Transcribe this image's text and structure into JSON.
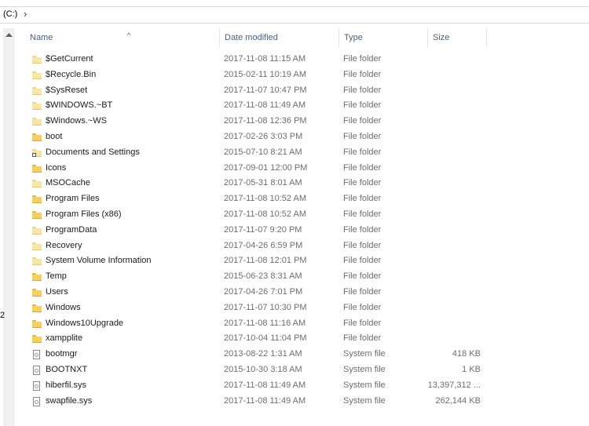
{
  "address": {
    "crumb": "(C:)",
    "separator": "›"
  },
  "nav": {
    "partial_number": "2"
  },
  "columns": {
    "name": "Name",
    "date": "Date modified",
    "type": "Type",
    "size": "Size",
    "sort_indicator": "^"
  },
  "files": [
    {
      "name": "$GetCurrent",
      "date": "2017-11-08 11:15 AM",
      "type": "File folder",
      "size": "",
      "icon": "folder-pale"
    },
    {
      "name": "$Recycle.Bin",
      "date": "2015-02-11 10:19 AM",
      "type": "File folder",
      "size": "",
      "icon": "folder-pale"
    },
    {
      "name": "$SysReset",
      "date": "2017-11-07 10:47 PM",
      "type": "File folder",
      "size": "",
      "icon": "folder-pale"
    },
    {
      "name": "$WINDOWS.~BT",
      "date": "2017-11-08 11:49 AM",
      "type": "File folder",
      "size": "",
      "icon": "folder-pale"
    },
    {
      "name": "$Windows.~WS",
      "date": "2017-11-08 12:36 PM",
      "type": "File folder",
      "size": "",
      "icon": "folder-pale"
    },
    {
      "name": "boot",
      "date": "2017-02-26 3:03 PM",
      "type": "File folder",
      "size": "",
      "icon": "folder"
    },
    {
      "name": "Documents and Settings",
      "date": "2015-07-10 8:21 AM",
      "type": "File folder",
      "size": "",
      "icon": "folder-link"
    },
    {
      "name": "Icons",
      "date": "2017-09-01 12:00 PM",
      "type": "File folder",
      "size": "",
      "icon": "folder"
    },
    {
      "name": "MSOCache",
      "date": "2017-05-31 8:01 AM",
      "type": "File folder",
      "size": "",
      "icon": "folder-pale"
    },
    {
      "name": "Program Files",
      "date": "2017-11-08 10:52 AM",
      "type": "File folder",
      "size": "",
      "icon": "folder"
    },
    {
      "name": "Program Files (x86)",
      "date": "2017-11-08 10:52 AM",
      "type": "File folder",
      "size": "",
      "icon": "folder"
    },
    {
      "name": "ProgramData",
      "date": "2017-11-07 9:20 PM",
      "type": "File folder",
      "size": "",
      "icon": "folder-pale"
    },
    {
      "name": "Recovery",
      "date": "2017-04-26 6:59 PM",
      "type": "File folder",
      "size": "",
      "icon": "folder-pale"
    },
    {
      "name": "System Volume Information",
      "date": "2017-11-08 12:01 PM",
      "type": "File folder",
      "size": "",
      "icon": "folder-pale"
    },
    {
      "name": "Temp",
      "date": "2015-06-23 8:31 AM",
      "type": "File folder",
      "size": "",
      "icon": "folder"
    },
    {
      "name": "Users",
      "date": "2017-04-26 7:01 PM",
      "type": "File folder",
      "size": "",
      "icon": "folder"
    },
    {
      "name": "Windows",
      "date": "2017-11-07 10:30 PM",
      "type": "File folder",
      "size": "",
      "icon": "folder"
    },
    {
      "name": "Windows10Upgrade",
      "date": "2017-11-08 11:16 AM",
      "type": "File folder",
      "size": "",
      "icon": "folder"
    },
    {
      "name": "xampplite",
      "date": "2017-10-04 11:04 PM",
      "type": "File folder",
      "size": "",
      "icon": "folder"
    },
    {
      "name": "bootmgr",
      "date": "2013-08-22 1:31 AM",
      "type": "System file",
      "size": "418 KB",
      "icon": "system-file"
    },
    {
      "name": "BOOTNXT",
      "date": "2015-10-30 3:18 AM",
      "type": "System file",
      "size": "1 KB",
      "icon": "system-file"
    },
    {
      "name": "hiberfil.sys",
      "date": "2017-11-08 11:49 AM",
      "type": "System file",
      "size": "13,397,312 ...",
      "icon": "system-file"
    },
    {
      "name": "swapfile.sys",
      "date": "2017-11-08 11:49 AM",
      "type": "System file",
      "size": "262,144 KB",
      "icon": "system-file"
    }
  ],
  "colors": {
    "folder": "#f4cf63",
    "folder_pale": "#f8e6a8",
    "header_text": "#4c607a",
    "meta_text": "#6d6d6d"
  }
}
